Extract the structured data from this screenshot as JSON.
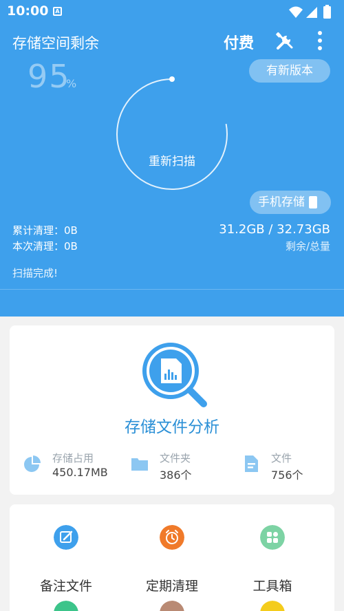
{
  "status_bar": {
    "time": "10:00",
    "notification_letter": "A"
  },
  "header": {
    "title": "存储空间剩余",
    "pay_label": "付费",
    "tools_icon": "tools-icon",
    "more_icon": "more-vertical-icon"
  },
  "gauge": {
    "percent": "95",
    "percent_sign": "%",
    "scan_button_label": "重新扫描",
    "progress": 0.95
  },
  "update_pill": {
    "label": "有新版本"
  },
  "storage_pill": {
    "label": "手机存储",
    "icon": "phone-icon"
  },
  "stats": {
    "cumulative": "累计清理：0B",
    "current": "本次清理：0B",
    "capacity": "31.2GB / 32.73GB",
    "capacity_label": "剩余/总量",
    "scan_status": "扫描完成!"
  },
  "analysis": {
    "title": "存储文件分析",
    "items": [
      {
        "label": "存储占用",
        "value": "450.17MB",
        "icon": "pie-chart-icon"
      },
      {
        "label": "文件夹",
        "value": "386个",
        "icon": "folder-icon"
      },
      {
        "label": "文件",
        "value": "756个",
        "icon": "document-icon"
      }
    ]
  },
  "tools": [
    {
      "label": "备注文件",
      "icon": "note-edit-icon",
      "color": "#3ea0ec"
    },
    {
      "label": "定期清理",
      "icon": "alarm-clock-icon",
      "color": "#f07a2a"
    },
    {
      "label": "工具箱",
      "icon": "toolbox-icon",
      "color": "#7dd3a4"
    }
  ],
  "colors": {
    "primary": "#3ea0ec",
    "accent_text": "#2a8fd6",
    "background": "#f2f2f2"
  }
}
